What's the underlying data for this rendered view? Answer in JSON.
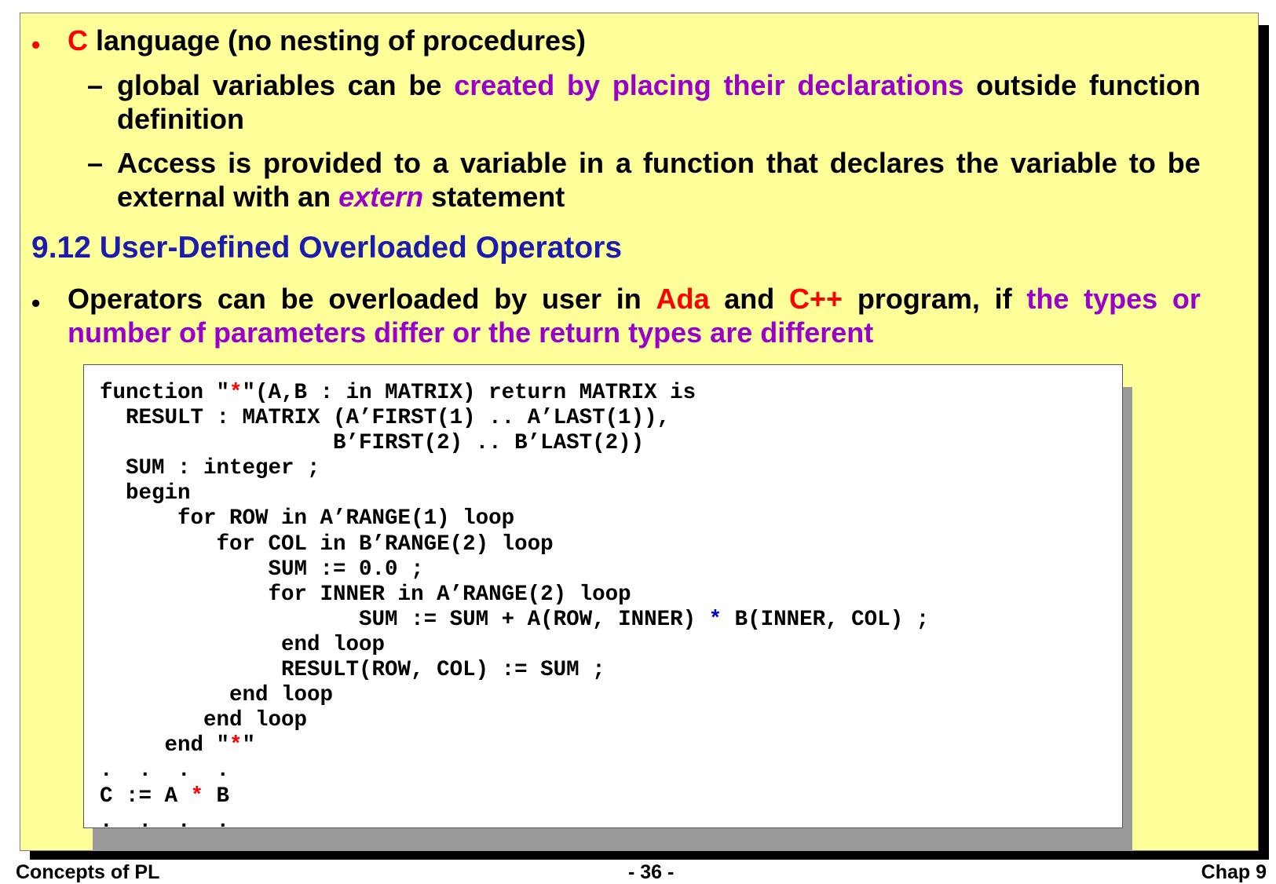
{
  "slide": {
    "bullet_c": {
      "bullet": "•",
      "lang": "C",
      "rest": " language (no nesting of procedures)"
    },
    "dash1": {
      "dash": "–",
      "line1_words": [
        "global",
        "variables",
        "can",
        "be"
      ],
      "line1_highlight": [
        "created",
        "by",
        "placing",
        "their",
        "declarations"
      ],
      "line1_tail": [
        "outside",
        "function"
      ],
      "line2": "definition"
    },
    "dash2": {
      "dash": "–",
      "line1_words": [
        "Access",
        "is",
        "provided",
        "to",
        "a",
        "variable",
        "in",
        "a",
        "function",
        "that",
        "declares",
        "the",
        "variable",
        "to",
        "be"
      ],
      "line2_pre": "external with an ",
      "line2_keyword": "extern",
      "line2_post": " statement"
    },
    "section_heading": "9.12 User-Defined Overloaded Operators",
    "bullet_ops": {
      "bullet": "•",
      "line1_words": [
        "Operators",
        "can",
        "be",
        "overloaded",
        "by",
        "user",
        "in"
      ],
      "ada": "Ada",
      "and": "and",
      "cpp": "C++",
      "program": "program,",
      "if": "if",
      "line1_highlight": [
        "the",
        "types",
        "or"
      ],
      "line2": "number of parameters differ or the return types are different"
    },
    "code": {
      "l1a": "function \"",
      "l1star": "*",
      "l1b": "\"(A,B : in MATRIX) return MATRIX is",
      "l2": "  RESULT : MATRIX (A’FIRST(1) .. A’LAST(1)),",
      "l3": "                  B’FIRST(2) .. B’LAST(2))",
      "l4": "  SUM : integer ;",
      "l5": "  begin",
      "l6": "      for ROW in A’RANGE(1) loop",
      "l7": "         for COL in B’RANGE(2) loop",
      "l8": "             SUM := 0.0 ;",
      "l9": "             for INNER in A’RANGE(2) loop",
      "l10a": "                    SUM := SUM + A(ROW, INNER) ",
      "l10star": "*",
      "l10b": " B(INNER, COL) ;",
      "l11": "              end loop",
      "l12": "              RESULT(ROW, COL) := SUM ;",
      "l13": "          end loop",
      "l14": "        end loop",
      "l15a": "     end \"",
      "l15star": "*",
      "l15b": "\"",
      "l16": ".  .  .  .",
      "l17a": "C := A ",
      "l17star": "*",
      "l17b": " B",
      "l18": ".  .  .  ."
    }
  },
  "footer": {
    "left": "Concepts of PL",
    "center": "- 36 -",
    "right": "Chap 9"
  }
}
